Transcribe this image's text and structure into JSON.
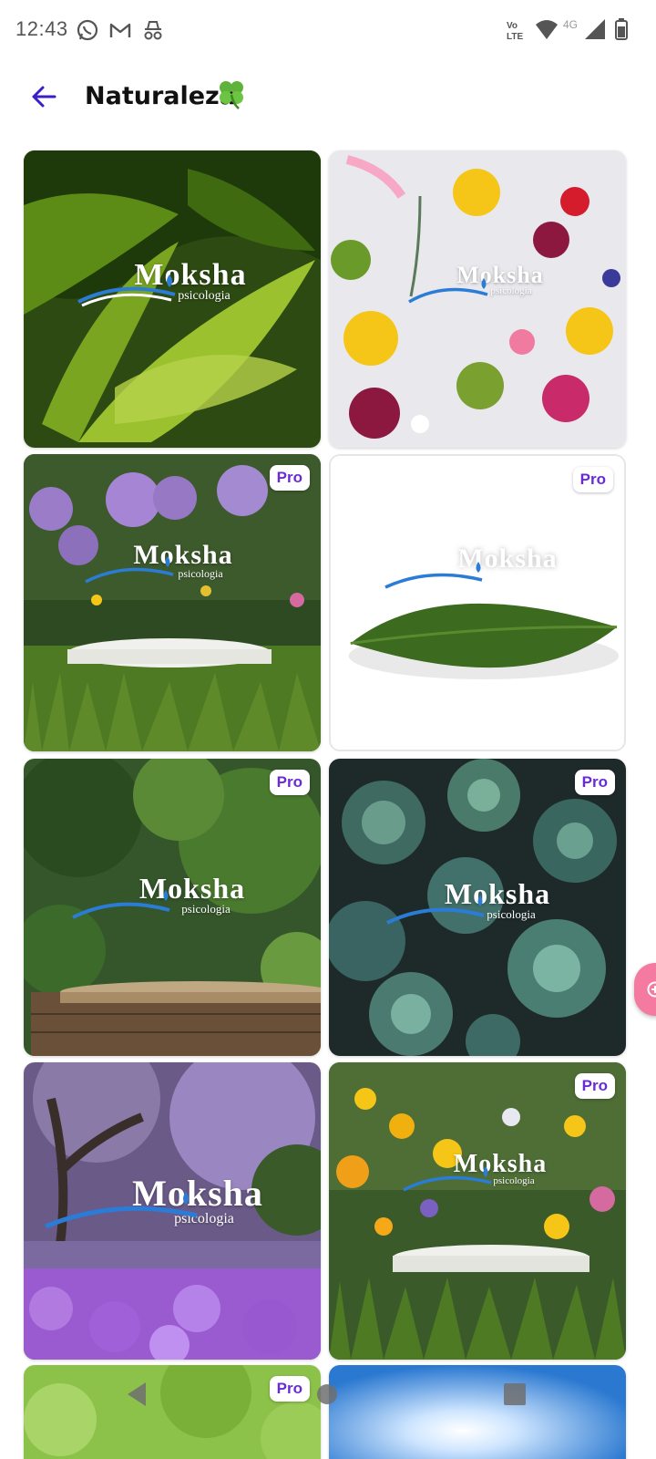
{
  "status_bar": {
    "time": "12:43",
    "left_icons": [
      "whatsapp-icon",
      "gmail-icon",
      "incognito-icon"
    ],
    "volte": "Vo)) LTE",
    "network": "4G",
    "right_icons": [
      "wifi-icon",
      "signal-icon",
      "battery-icon"
    ]
  },
  "header": {
    "title": "Naturaleza",
    "emoji": "clover-icon",
    "accent_color": "#3b1fc4"
  },
  "logo": {
    "word": "Moksha",
    "sub": "psicologia"
  },
  "pro_label": "Pro",
  "tiles": [
    {
      "name": "tropical-leaves",
      "pro": false
    },
    {
      "name": "flat-flowers",
      "pro": false
    },
    {
      "name": "allium-garden",
      "pro": true
    },
    {
      "name": "single-leaf",
      "pro": true
    },
    {
      "name": "tree-stump-jungle",
      "pro": true
    },
    {
      "name": "succulents",
      "pro": true
    },
    {
      "name": "jacaranda-park",
      "pro": false
    },
    {
      "name": "wildflower-meadow",
      "pro": true
    },
    {
      "name": "green-bokeh",
      "pro": true
    },
    {
      "name": "sunny-sky",
      "pro": false
    }
  ],
  "colors": {
    "pro_text": "#6a2bd6",
    "fab": "#f47aa0"
  }
}
